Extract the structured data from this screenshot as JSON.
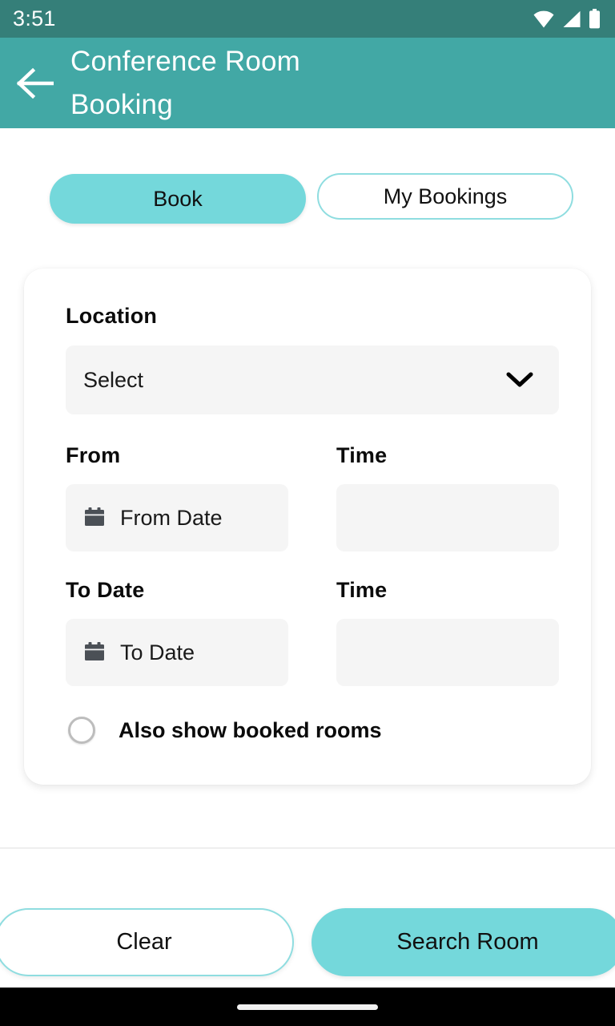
{
  "status_bar": {
    "time": "3:51",
    "icons": [
      "wifi-icon",
      "cellular-signal-icon",
      "battery-icon"
    ],
    "background": "#357f79"
  },
  "app_bar": {
    "title": "Conference Room Booking",
    "back_icon": "arrow-left-icon",
    "background": "#42a8a5"
  },
  "tabs": [
    {
      "label": "Book",
      "selected": true
    },
    {
      "label": "My Bookings",
      "selected": false
    }
  ],
  "form": {
    "location": {
      "label": "Location",
      "value": "Select",
      "placeholder": "Select",
      "chevron_icon": "chevron-down-icon"
    },
    "from": {
      "label": "From",
      "date_value": "From Date",
      "date_placeholder": "From Date",
      "calendar_icon": "calendar-icon",
      "time_label": "Time",
      "time_value": "",
      "time_placeholder": ""
    },
    "to": {
      "label": "To Date",
      "date_value": "To Date",
      "date_placeholder": "To Date",
      "calendar_icon": "calendar-icon",
      "time_label": "Time",
      "time_value": "",
      "time_placeholder": ""
    },
    "booked_rooms": {
      "label": "Also show booked rooms",
      "checked": false
    }
  },
  "actions": {
    "clear_label": "Clear",
    "search_label": "Search Room"
  },
  "colors": {
    "accent": "#74d8db",
    "accent_border": "#8fdde0",
    "app_bar": "#42a8a5",
    "status_bar": "#357f79",
    "input_bg": "#f5f5f5",
    "page_bg": "#ffffff",
    "nav_bar": "#000000"
  }
}
